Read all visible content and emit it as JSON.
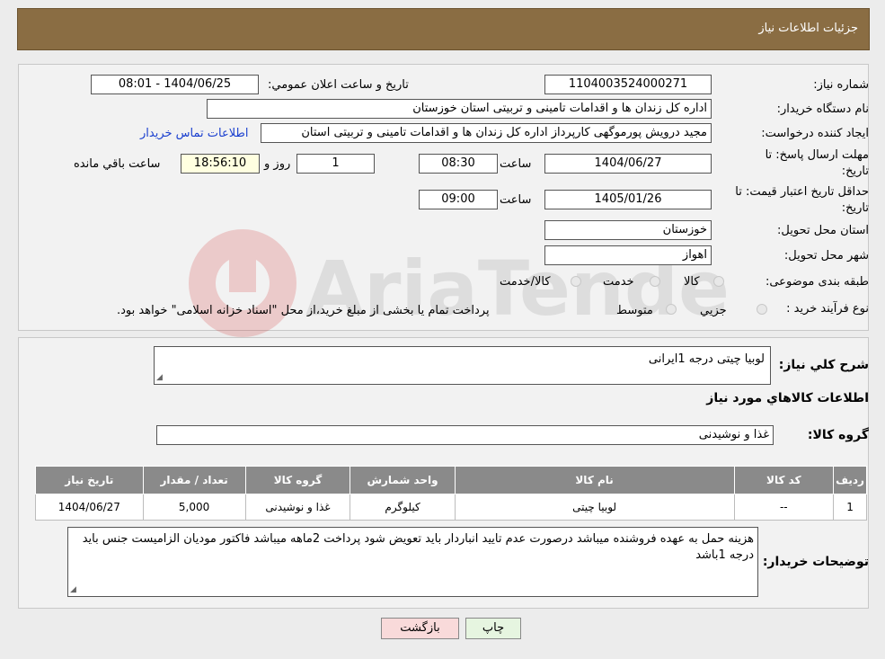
{
  "header": {
    "title": "جزئیات اطلاعات نیاز"
  },
  "form": {
    "need_number_label": "شماره نیاز:",
    "need_number": "1104003524000271",
    "announce_label": "تاریخ و ساعت اعلان عمومي:",
    "announce_value": "1404/06/25 - 08:01",
    "buyer_label": "نام دستگاه خریدار:",
    "buyer_value": "اداره کل زندان ها و اقدامات تامینی و تربیتی استان خوزستان",
    "creator_label": "ایجاد کننده درخواست:",
    "creator_value": "مجید درویش پورموگهی کارپرداز اداره کل زندان ها و اقدامات تامینی و تربیتی استان",
    "contact_link": "اطلاعات تماس خریدار",
    "deadline_label_1": "مهلت ارسال پاسخ: تا",
    "deadline_label_2": "تاریخ:",
    "deadline_date": "1404/06/27",
    "time_label": "ساعت",
    "deadline_time": "08:30",
    "days_value": "1",
    "days_label": "روز و",
    "remaining_time": "18:56:10",
    "remaining_label": "ساعت باقي مانده",
    "validity_label_1": "حداقل تاریخ اعتبار قیمت: تا",
    "validity_label_2": "تاریخ:",
    "validity_date": "1405/01/26",
    "validity_time": "09:00",
    "province_label": "استان محل تحویل:",
    "province_value": "خوزستان",
    "city_label": "شهر محل تحویل:",
    "city_value": "اهواز",
    "category_label": "طبقه بندی موضوعی:",
    "category_options": [
      "کالا",
      "خدمت",
      "کالا/خدمت"
    ],
    "purchase_type_label": "نوع فرآیند خرید :",
    "purchase_options": [
      "جزیي",
      "متوسط"
    ],
    "purchase_note": "پرداخت تمام یا بخشی از مبلغ خرید،از محل \"اسناد خزانه اسلامی\" خواهد بود."
  },
  "details": {
    "summary_label": "شرح کلي نیاز:",
    "summary_value": "لوبیا چیتی درجه 1ایرانی",
    "items_heading": "اطلاعات کالاهاي مورد نیاز",
    "group_label": "گروه کالا:",
    "group_value": "غذا و نوشیدنی",
    "table": {
      "headers": [
        "ردیف",
        "کد کالا",
        "نام کالا",
        "واحد شمارش",
        "گروه کالا",
        "تعداد / مقدار",
        "تاریخ نیاز"
      ],
      "rows": [
        [
          "1",
          "--",
          "لوبیا چیتی",
          "کیلوگرم",
          "غذا و نوشیدنی",
          "5,000",
          "1404/06/27"
        ]
      ]
    },
    "buyer_notes_label": "توضیحات خریدار:",
    "buyer_notes_value": "هزینه حمل به عهده فروشنده میباشد درصورت عدم تایید انباردار باید تعویض شود پرداخت 2ماهه میباشد فاکتور مودیان الزامیست جنس باید درجه 1باشد"
  },
  "buttons": {
    "print": "چاپ",
    "back": "بازگشت"
  },
  "watermark": {
    "text": "AriaTender.neT"
  },
  "colors": {
    "header_bg": "#8a6d43",
    "link": "#1a3fcf",
    "back_bg": "#f9dada",
    "print_bg": "#e6f5e0"
  }
}
